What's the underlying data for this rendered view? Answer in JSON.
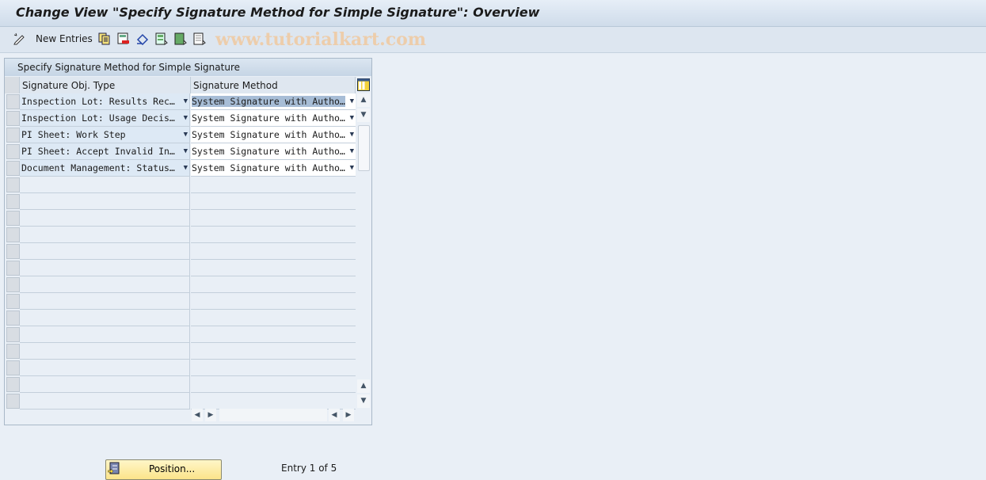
{
  "window": {
    "title": "Change View \"Specify Signature Method for Simple Signature\": Overview"
  },
  "toolbar": {
    "new_entries_label": "New Entries",
    "icons": [
      "edit-pencil-icon",
      "copy-icon",
      "delete-icon",
      "undo-icon",
      "select-all-icon",
      "select-block-icon",
      "deselect-all-icon"
    ],
    "watermark": "www.tutorialkart.com"
  },
  "table": {
    "title": "Specify Signature Method for Simple Signature",
    "columns": [
      "Signature Obj. Type",
      "Signature Method"
    ],
    "rows": [
      [
        "Inspection Lot: Results Rec…",
        "System Signature with Autho…"
      ],
      [
        "Inspection Lot: Usage Decis…",
        "System Signature with Autho…"
      ],
      [
        "PI Sheet: Work Step",
        "System Signature with Autho…"
      ],
      [
        "PI Sheet: Accept Invalid In…",
        "System Signature with Autho…"
      ],
      [
        "Document Management: Status…",
        "System Signature with Autho…"
      ]
    ],
    "selected_row": 0
  },
  "footer": {
    "position_label": "Position...",
    "entry_text": "Entry 1 of 5"
  },
  "colors": {
    "accent_highlight": "#a7bdd6",
    "button_yellow": "#fbe48a"
  }
}
